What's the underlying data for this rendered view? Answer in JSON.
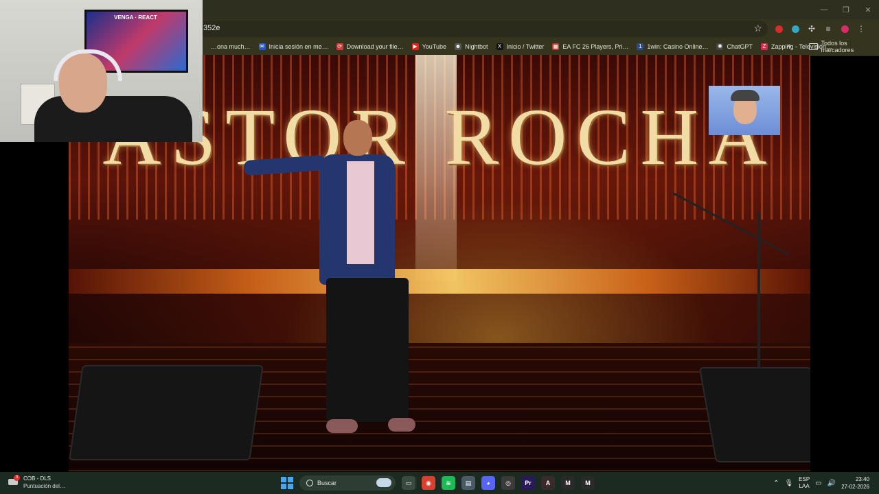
{
  "browser": {
    "url": "352e",
    "bookmarks": [
      {
        "label": "…ona much…",
        "icon_color": "#35351f",
        "icon": ""
      },
      {
        "label": "Inicia sesión en me…",
        "icon_color": "#2a56c6",
        "icon": "✉"
      },
      {
        "label": "Download your file…",
        "icon_color": "#d43a3a",
        "icon": "⟳"
      },
      {
        "label": "YouTube",
        "icon_color": "#e62117",
        "icon": "▶"
      },
      {
        "label": "Nightbot",
        "icon_color": "#555555",
        "icon": "☻"
      },
      {
        "label": "Inicio / Twitter",
        "icon_color": "#111111",
        "icon": "X"
      },
      {
        "label": "EA FC 26 Players, Pri…",
        "icon_color": "#c0392b",
        "icon": "▦"
      },
      {
        "label": "1win: Casino Online…",
        "icon_color": "#2c4a8a",
        "icon": "1"
      },
      {
        "label": "ChatGPT",
        "icon_color": "#444444",
        "icon": "✺"
      },
      {
        "label": "Zapping - Televisión…",
        "icon_color": "#d42a4a",
        "icon": "Z"
      }
    ],
    "more_glyph": "»",
    "all_bookmarks": "Todos los marcadores",
    "extension_colors": [
      "#d62c2c",
      "#36a6c4",
      "#cfcfcf",
      "#cfcfcf",
      "#d82c6a"
    ]
  },
  "video": {
    "stage_title": "ASTOR ROCHA"
  },
  "webcam": {
    "tv_text": "VENGA · REACT"
  },
  "taskbar": {
    "notification": {
      "badge": "3",
      "title": "COB - DLS",
      "subtitle": "Puntuación del…"
    },
    "search_label": "Buscar",
    "apps": [
      {
        "name": "file-explorer",
        "glyph": "▭",
        "color": "#3a4a40"
      },
      {
        "name": "chrome",
        "glyph": "◉",
        "color": "#d8412f"
      },
      {
        "name": "spotify",
        "glyph": "≋",
        "color": "#1db954"
      },
      {
        "name": "app-grey",
        "glyph": "▤",
        "color": "#4a5a66"
      },
      {
        "name": "discord",
        "glyph": "◕",
        "color": "#5865f2"
      },
      {
        "name": "obs",
        "glyph": "◎",
        "color": "#3a3a3a"
      },
      {
        "name": "premiere",
        "glyph": "Pr",
        "color": "#2a1a5a"
      },
      {
        "name": "affinity",
        "glyph": "A",
        "color": "#3a2a2a"
      },
      {
        "name": "app-m1",
        "glyph": "M",
        "color": "#2a2a2a"
      },
      {
        "name": "app-m2",
        "glyph": "M",
        "color": "#2a2a2a"
      }
    ],
    "language": "ESP",
    "region": "LAA",
    "time": "23:40",
    "date": "27-02-2026"
  }
}
